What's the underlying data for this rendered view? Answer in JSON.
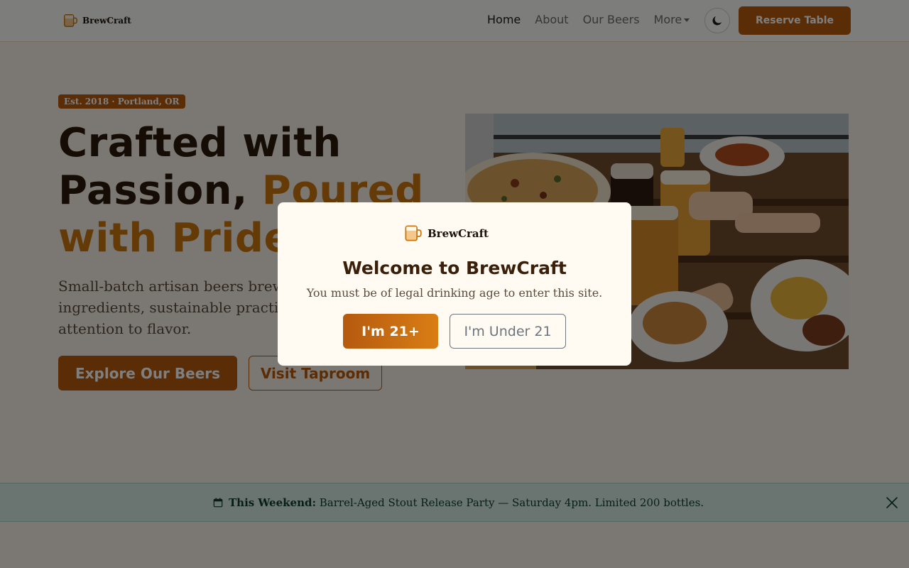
{
  "brand": {
    "name": "BrewCraft",
    "icon": "beer-mug-icon"
  },
  "nav": {
    "links": [
      {
        "label": "Home",
        "active": true
      },
      {
        "label": "About",
        "active": false
      },
      {
        "label": "Our Beers",
        "active": false
      },
      {
        "label": "More",
        "active": false,
        "dropdown": true
      }
    ],
    "theme_toggle_icon": "moon-icon",
    "cta_label": "Reserve Table"
  },
  "hero": {
    "badge": "Est. 2018 · Portland, OR",
    "title_part1": "Crafted with Passion, ",
    "title_accent": "Poured with Pride",
    "description": "Small-batch artisan beers brewed with locally sourced ingredients, sustainable practices, and obsessive attention to flavor.",
    "primary_button": "Explore Our Beers",
    "secondary_button": "Visit Taproom"
  },
  "announcement": {
    "icon": "calendar-icon",
    "label": "This Weekend:",
    "text": " Barrel-Aged Stout Release Party — Saturday 4pm. Limited 200 bottles.",
    "close_icon": "close-icon"
  },
  "modal": {
    "brand": "BrewCraft",
    "title": "Welcome to BrewCraft",
    "subtitle": "You must be of legal drinking age to enter this site.",
    "confirm_label": "I'm 21+",
    "decline_label": "I'm Under 21"
  },
  "colors": {
    "accent": "#b55a0f",
    "accent_light": "#c8750f",
    "announcement_bg": "#d4ebe4"
  }
}
